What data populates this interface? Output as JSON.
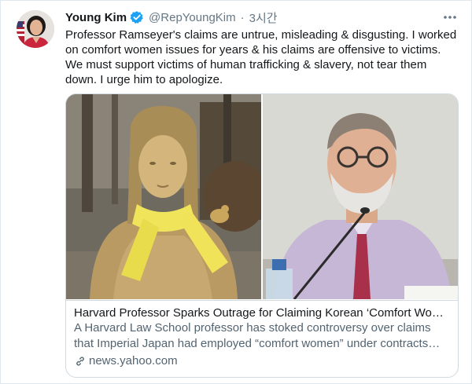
{
  "tweet": {
    "author_name": "Young Kim",
    "author_handle": "@RepYoungKim",
    "time_separator": "·",
    "time": "3시간",
    "text": "Professor Ramseyer's claims are untrue, misleading & disgusting. I worked on comfort women issues for years & his claims are offensive to victims. We must support victims of human trafficking & slavery, not tear them down. I urge him to apologize."
  },
  "card": {
    "title": "Harvard Professor Sparks Outrage for Claiming Korean ‘Comfort Wome...",
    "description": "A Harvard Law School professor has stoked controversy over claims that Imperial Japan had employed “comfort women” under contracts during ...",
    "domain": "news.yahoo.com",
    "image_left": "comfort-woman-statue-photo",
    "image_right": "professor-photo"
  },
  "colors": {
    "verified_badge": "#1da1f2",
    "text_primary": "#14171a",
    "text_secondary": "#657786",
    "border": "#cfd9de"
  },
  "icons": {
    "verified": "verified-badge-icon",
    "more": "more-options-icon",
    "link": "link-icon"
  }
}
